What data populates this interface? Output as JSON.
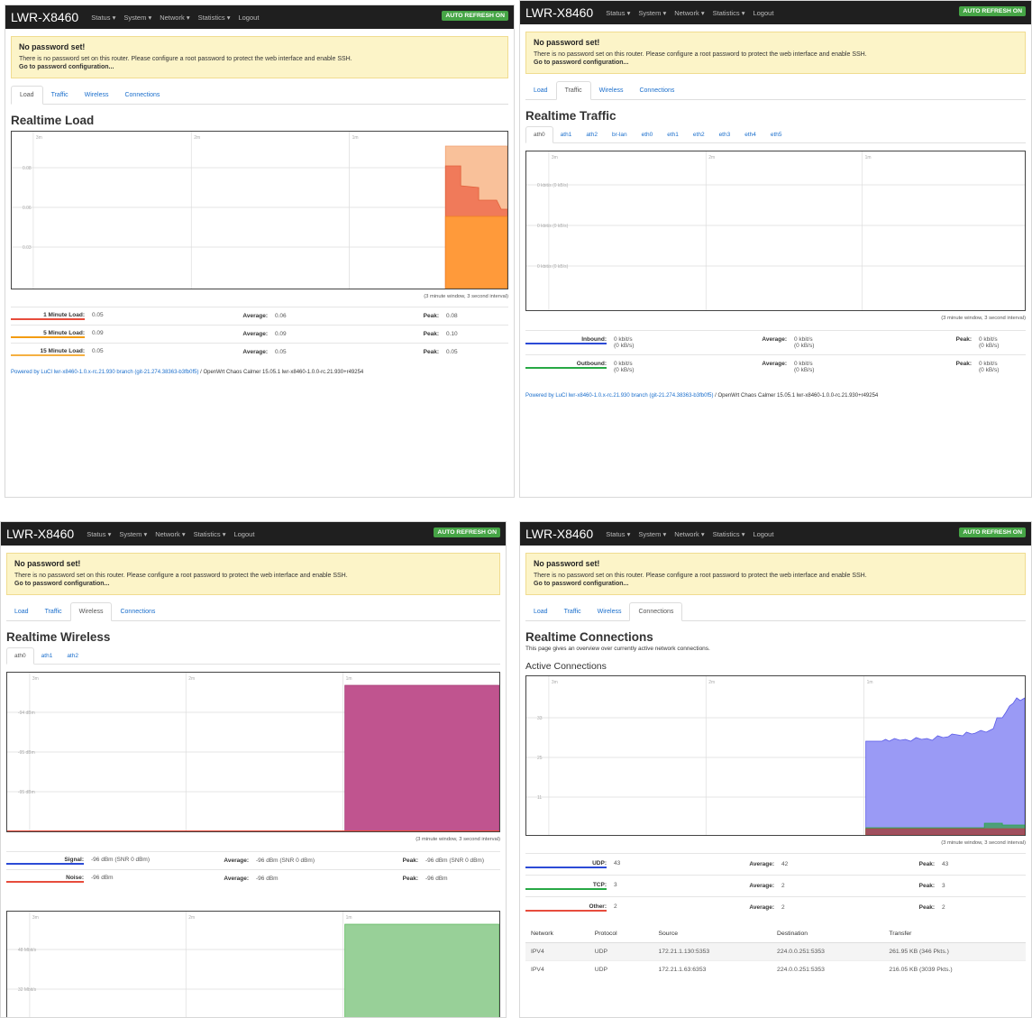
{
  "common": {
    "brand": "LWR-X8460",
    "menu": [
      "Status",
      "System",
      "Network",
      "Statistics",
      "Logout"
    ],
    "auto_refresh": "AUTO REFRESH ON",
    "alert_title": "No password set!",
    "alert_text": "There is no password set on this router. Please configure a root password to protect the web interface and enable SSH.",
    "alert_link": "Go to password configuration...",
    "tabs": [
      "Load",
      "Traffic",
      "Wireless",
      "Connections"
    ],
    "x_ticks": [
      "3m",
      "2m",
      "1m"
    ],
    "window_caption": "(3 minute window, 3 second interval)",
    "footer_link": "Powered by LuCI lwr-x8460-1.0.x-rc.21.930 branch (git-21.274.38363-b3fb0f5)",
    "footer_rest": " / OpenWrt Chaos Calmer 15.05.1 lwr-x8460-1.0.0-rc.21.930+r49254",
    "average_label": "Average:",
    "peak_label": "Peak:",
    "colors": {
      "navbar": "#1f1f1f",
      "accent_link": "#1a6ecc",
      "auto_refresh": "#46a546",
      "alert_bg": "#fcf4c8"
    }
  },
  "load": {
    "title": "Realtime Load",
    "y_ticks": [
      "0.08",
      "0.06",
      "0.03"
    ],
    "rows": [
      {
        "label": "1 Minute Load:",
        "value": "0.05",
        "avg": "0.06",
        "peak": "0.08",
        "color": "#e74c3c"
      },
      {
        "label": "5 Minute Load:",
        "value": "0.09",
        "avg": "0.09",
        "peak": "0.10",
        "color": "#f39c12"
      },
      {
        "label": "15 Minute Load:",
        "value": "0.05",
        "avg": "0.05",
        "peak": "0.05",
        "color": "#f5b041"
      }
    ]
  },
  "traffic": {
    "title": "Realtime Traffic",
    "interfaces": [
      "ath0",
      "ath1",
      "ath2",
      "br-lan",
      "eth0",
      "eth1",
      "eth2",
      "eth3",
      "eth4",
      "eth5"
    ],
    "y_ticks": [
      "0 kbit/s (0 kB/s)",
      "0 kbit/s (0 kB/s)",
      "0 kbit/s (0 kB/s)"
    ],
    "rows": [
      {
        "label": "Inbound:",
        "value": "0 kbit/s",
        "value2": "(0 kB/s)",
        "avg": "0 kbit/s",
        "avg2": "(0 kB/s)",
        "peak": "0 kbit/s",
        "peak2": "(0 kB/s)",
        "color": "#2c4bd6"
      },
      {
        "label": "Outbound:",
        "value": "0 kbit/s",
        "value2": "(0 kB/s)",
        "avg": "0 kbit/s",
        "avg2": "(0 kB/s)",
        "peak": "0 kbit/s",
        "peak2": "(0 kB/s)",
        "color": "#27a844"
      }
    ]
  },
  "wireless": {
    "title": "Realtime Wireless",
    "interfaces": [
      "ath0",
      "ath1",
      "ath2"
    ],
    "y_ticks": [
      "-94 dBm",
      "-95 dBm",
      "-95 dBm"
    ],
    "rows": [
      {
        "label": "Signal:",
        "value": "-96 dBm (SNR 0 dBm)",
        "avg": "-96 dBm (SNR 0 dBm)",
        "peak": "-96 dBm (SNR 0 dBm)",
        "color": "#2c4bd6"
      },
      {
        "label": "Noise:",
        "value": "-96 dBm",
        "avg": "-96 dBm",
        "peak": "-96 dBm",
        "color": "#e74c3c"
      }
    ],
    "rate_y_ticks": [
      "48 Mbit/s",
      "32 Mbit/s"
    ]
  },
  "connections": {
    "title": "Realtime Connections",
    "description": "This page gives an overview over currently active network connections.",
    "subtitle": "Active Connections",
    "y_ticks": [
      "33",
      "25",
      "11"
    ],
    "rows": [
      {
        "label": "UDP:",
        "value": "43",
        "avg": "42",
        "peak": "43",
        "color": "#2c4bd6"
      },
      {
        "label": "TCP:",
        "value": "3",
        "avg": "2",
        "peak": "3",
        "color": "#27a844"
      },
      {
        "label": "Other:",
        "value": "2",
        "avg": "2",
        "peak": "2",
        "color": "#e74c3c"
      }
    ],
    "table_headers": [
      "Network",
      "Protocol",
      "Source",
      "Destination",
      "Transfer"
    ],
    "table_rows": [
      [
        "IPV4",
        "UDP",
        "172.21.1.130:5353",
        "224.0.0.251:5353",
        "261.95 KB (346 Pkts.)"
      ],
      [
        "IPV4",
        "UDP",
        "172.21.1.63:6353",
        "224.0.0.251:5353",
        "216.05 KB (3039 Pkts.)"
      ]
    ]
  }
}
